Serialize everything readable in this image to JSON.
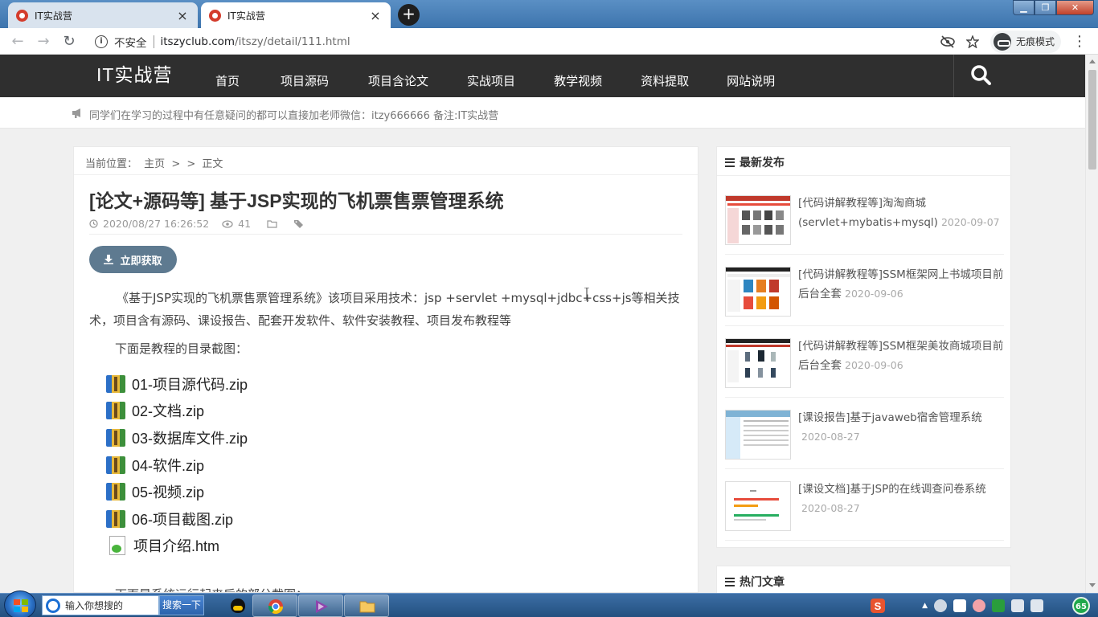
{
  "browser": {
    "tabs": [
      {
        "title": "IT实战营",
        "close": "×"
      },
      {
        "title": "IT实战营",
        "close": "×"
      }
    ],
    "new_tab": "+",
    "window_controls": {
      "minimize": "▁",
      "maximize": "❐",
      "close": "✕"
    },
    "nav": {
      "back": "←",
      "forward": "→",
      "reload": "↻"
    },
    "address": {
      "security_label": "不安全",
      "host": "itszyclub.com",
      "path": "/itszy/detail/111.html"
    },
    "incognito_label": "无痕模式",
    "menu": "⋮"
  },
  "site": {
    "logo": "IT实战营",
    "nav": [
      "首页",
      "项目源码",
      "项目含论文",
      "实战项目",
      "教学视频",
      "资料提取",
      "网站说明"
    ],
    "notice": "同学们在学习的过程中有任意疑问的都可以直接加老师微信：itzy666666 备注:IT实战营"
  },
  "article": {
    "breadcrumb": {
      "label": "当前位置：",
      "home": "主页",
      "sep1": ">",
      "sep2": ">",
      "current": "正文"
    },
    "title": "[论文+源码等] 基于JSP实现的飞机票售票管理系统",
    "date": "2020/08/27 16:26:52",
    "views": "41",
    "get_button": "立即获取",
    "paragraph1": "《基于JSP实现的飞机票售票管理系统》该项目采用技术：jsp +servlet +mysql+jdbc+css+js等相关技术，项目含有源码、课设报告、配套开发软件、软件安装教程、项目发布教程等",
    "paragraph2": "下面是教程的目录截图：",
    "files": [
      "01-项目源代码.zip",
      "02-文档.zip",
      "03-数据库文件.zip",
      "04-软件.zip",
      "05-视频.zip",
      "06-项目截图.zip",
      "项目介绍.htm"
    ],
    "paragraph3": "下面是系统运行起来后的部分截图："
  },
  "sidebar": {
    "latest_title": "最新发布",
    "posts": [
      {
        "title": "[代码讲解教程等]淘淘商城(servlet+mybatis+mysql)",
        "date": "2020-09-07"
      },
      {
        "title": "[代码讲解教程等]SSM框架网上书城项目前后台全套",
        "date": "2020-09-06"
      },
      {
        "title": "[代码讲解教程等]SSM框架美妆商城项目前后台全套",
        "date": "2020-09-06"
      },
      {
        "title": "[课设报告]基于javaweb宿舍管理系统",
        "date": "2020-08-27"
      },
      {
        "title": "[课设文档]基于JSP的在线调查问卷系统",
        "date": "2020-08-27"
      }
    ],
    "hot_title": "热门文章"
  },
  "taskbar": {
    "search_placeholder": "输入你想搜的",
    "search_button": "搜索一下",
    "tray_badge": "65"
  },
  "colors": {
    "header_bg": "#2f2f2f",
    "button_bg": "#5e7a90",
    "page_bg": "#f0f0f0"
  }
}
